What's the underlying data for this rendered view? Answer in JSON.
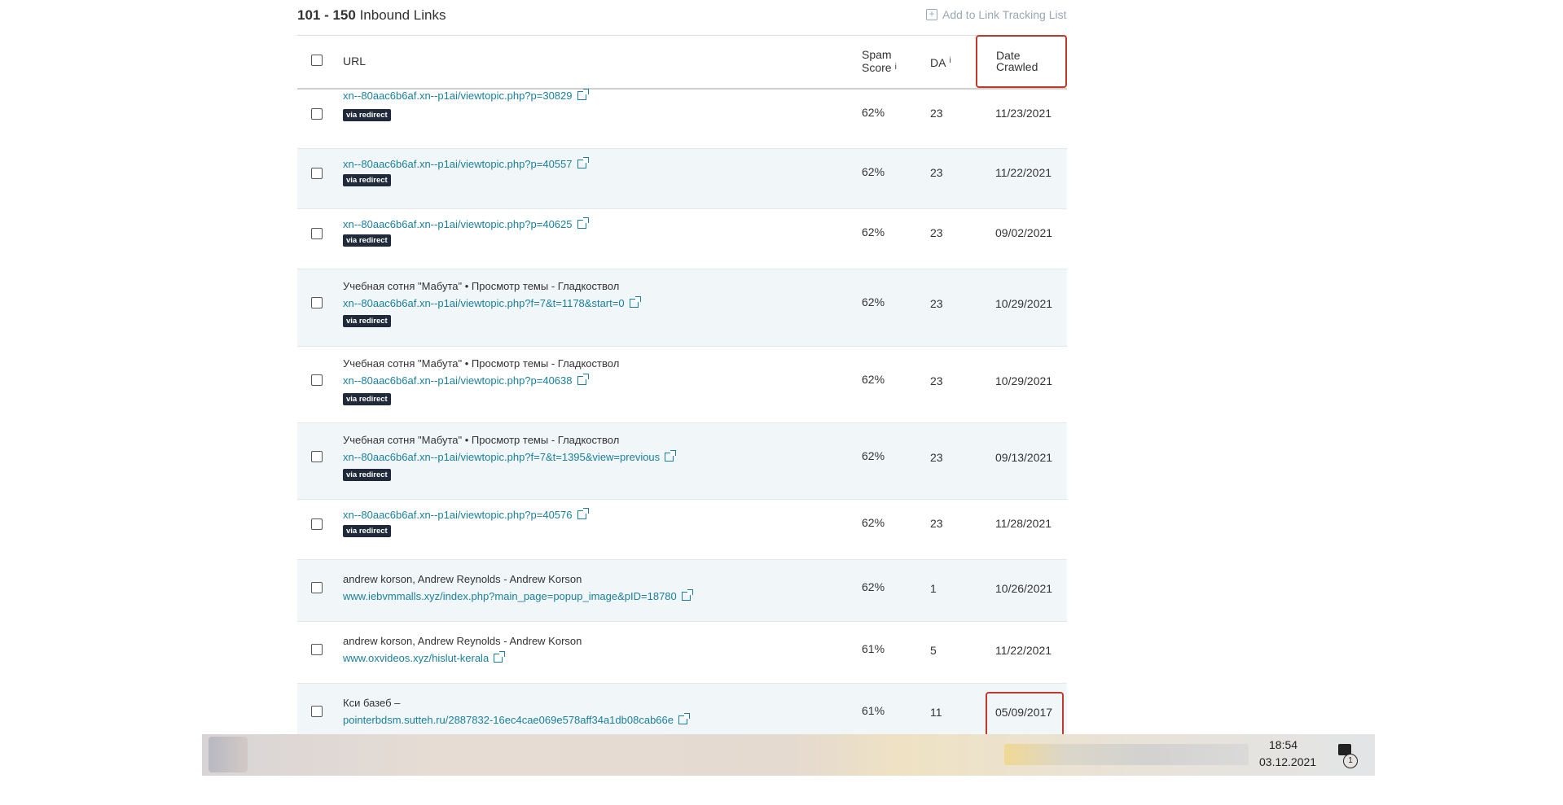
{
  "header": {
    "range": "101 - 150",
    "range_label": "Inbound Links",
    "add_tracking": "Add to Link Tracking List"
  },
  "columns": {
    "url": "URL",
    "spam_line1": "Spam",
    "spam_line2": "Score",
    "da": "DA",
    "info_glyph": "i",
    "date_line1": "Date",
    "date_line2": "Crawled"
  },
  "badge_label": "via redirect",
  "rows": [
    {
      "url": "xn--80aac6b6af.xn--p1ai/viewtopic.php?p=30829",
      "spam": "62%",
      "da": "23",
      "date": "11/23/2021"
    },
    {
      "url": "xn--80aac6b6af.xn--p1ai/viewtopic.php?p=40557",
      "spam": "62%",
      "da": "23",
      "date": "11/22/2021"
    },
    {
      "url": "xn--80aac6b6af.xn--p1ai/viewtopic.php?p=40625",
      "spam": "62%",
      "da": "23",
      "date": "09/02/2021"
    },
    {
      "title": "Учебная сотня \"Мабута\" • Просмотр темы - Гладкоствол",
      "url": "xn--80aac6b6af.xn--p1ai/viewtopic.php?f=7&t=1178&start=0",
      "spam": "62%",
      "da": "23",
      "date": "10/29/2021"
    },
    {
      "title": "Учебная сотня \"Мабута\" • Просмотр темы - Гладкоствол",
      "url": "xn--80aac6b6af.xn--p1ai/viewtopic.php?p=40638",
      "spam": "62%",
      "da": "23",
      "date": "10/29/2021"
    },
    {
      "title": "Учебная сотня \"Мабута\" • Просмотр темы - Гладкоствол",
      "url": "xn--80aac6b6af.xn--p1ai/viewtopic.php?f=7&t=1395&view=previous",
      "spam": "62%",
      "da": "23",
      "date": "09/13/2021"
    },
    {
      "url": "xn--80aac6b6af.xn--p1ai/viewtopic.php?p=40576",
      "spam": "62%",
      "da": "23",
      "date": "11/28/2021"
    },
    {
      "title": "andrew korson, Andrew Reynolds - Andrew Korson",
      "url": "www.iebvmmalls.xyz/index.php?main_page=popup_image&pID=18780",
      "spam": "62%",
      "da": "1",
      "date": "10/26/2021"
    },
    {
      "title": "andrew korson, Andrew Reynolds - Andrew Korson",
      "url": "www.oxvideos.xyz/hislut-kerala",
      "spam": "61%",
      "da": "5",
      "date": "11/22/2021"
    },
    {
      "title": "Кси базеб –",
      "url": "pointerbdsm.sutteh.ru/2887832-16ec4cae069e578aff34a1db08cab66e",
      "spam": "61%",
      "da": "11",
      "date": "05/09/2017"
    }
  ],
  "taskbar": {
    "time": "18:54",
    "date": "03.12.2021",
    "notification_count": "1"
  },
  "colors": {
    "link": "#1a7f9c",
    "highlight": "#c0392b",
    "badge_bg": "#202a3a",
    "row_alt": "#f1f6f8"
  }
}
